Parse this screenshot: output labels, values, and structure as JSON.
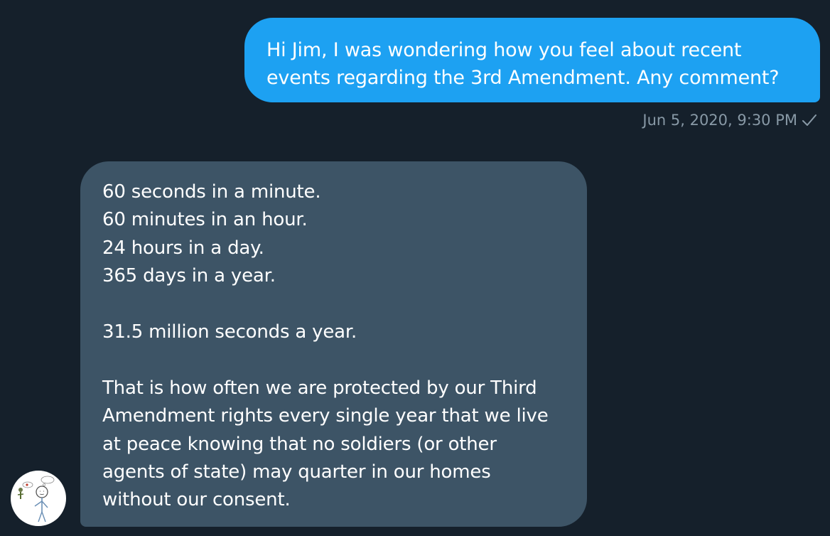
{
  "sent_message": {
    "lines": [
      "Hi Jim, I was wondering how you feel about recent",
      "events regarding the 3rd Amendment. Any comment?"
    ],
    "timestamp": "Jun 5, 2020, 9:30 PM",
    "status_icon": "check-icon"
  },
  "received_message": {
    "lines": [
      "60 seconds in a minute.",
      "60 minutes in an hour.",
      "24 hours in a day.",
      "365 days in a year.",
      "",
      "31.5 million seconds a year.",
      "",
      "That is how often we are protected by our Third",
      "Amendment rights every single year that we live",
      "at peace knowing that no soldiers (or other",
      "agents of state) may quarter in our homes",
      "without our consent."
    ],
    "avatar_icon": "stick-figure-avatar"
  },
  "colors": {
    "background": "#15202b",
    "sent_bubble": "#1da1f2",
    "received_bubble": "#3d5466",
    "meta_text": "#8899a6"
  }
}
